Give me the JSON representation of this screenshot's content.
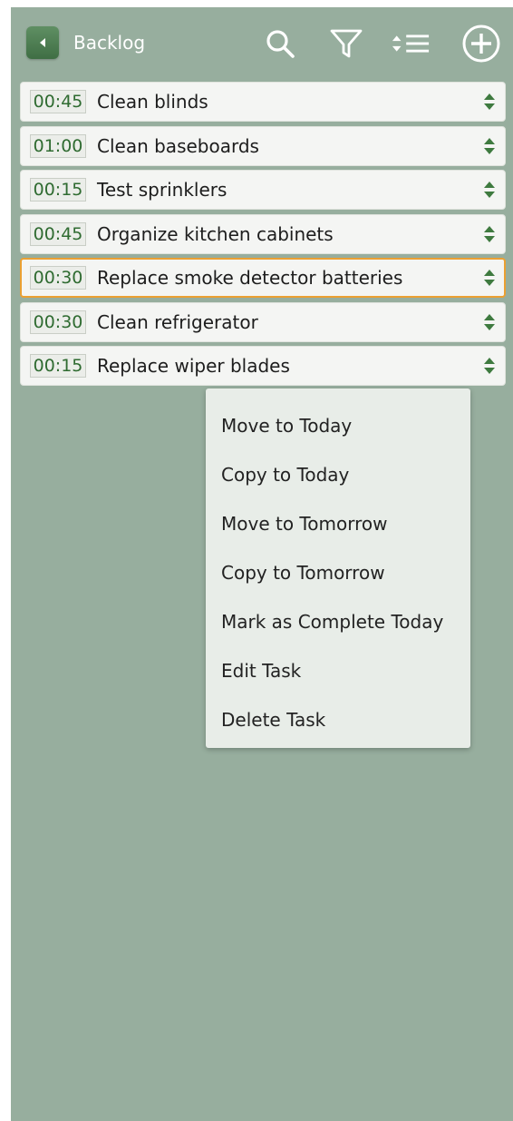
{
  "header": {
    "title": "Backlog",
    "back_icon": "back-arrow-icon",
    "actions": [
      "search-icon",
      "filter-icon",
      "sort-list-icon",
      "add-circle-icon"
    ]
  },
  "tasks": [
    {
      "time": "00:45",
      "name": "Clean blinds"
    },
    {
      "time": "01:00",
      "name": "Clean baseboards"
    },
    {
      "time": "00:15",
      "name": "Test sprinklers"
    },
    {
      "time": "00:45",
      "name": "Organize kitchen cabinets"
    },
    {
      "time": "00:30",
      "name": "Replace smoke detector batteries"
    },
    {
      "time": "00:30",
      "name": "Clean refrigerator"
    },
    {
      "time": "00:15",
      "name": "Replace wiper blades"
    }
  ],
  "context_menu": {
    "items": [
      "Move to Today",
      "Copy to Today",
      "Move to Tomorrow",
      "Copy to Tomorrow",
      "Mark as Complete Today",
      "Edit Task",
      "Delete Task"
    ]
  },
  "colors": {
    "background": "#97ae9e",
    "accent_green": "#2f6b31",
    "selected_border": "#eba032"
  }
}
